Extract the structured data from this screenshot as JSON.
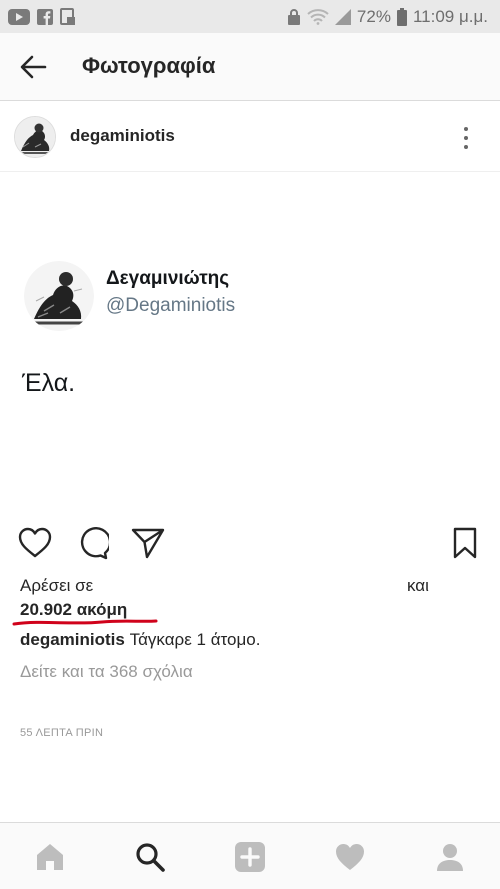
{
  "status_bar": {
    "battery": "72%",
    "time": "11:09 μ.μ.",
    "icons_left": [
      "youtube-icon",
      "facebook-icon",
      "gallery-icon"
    ],
    "icons_right": [
      "lock-icon",
      "wifi-icon",
      "signal-icon",
      "battery-icon"
    ]
  },
  "header": {
    "title": "Φωτογραφία",
    "back_icon": "arrow-left-icon"
  },
  "post": {
    "username": "degaminiotis",
    "menu_icon": "more-vertical-icon",
    "photo": {
      "display_name": "Δεγαμινιώτης",
      "handle": "@Degaminiotis",
      "text": "Έλα."
    },
    "actions": [
      "heart-icon",
      "comment-icon",
      "share-icon",
      "bookmark-icon"
    ],
    "likes_prefix": "Αρέσει σε",
    "likes_and": "και",
    "likes_count": "20.902 ακόμη",
    "caption_user": "degaminiotis",
    "caption_text": " Τάγκαρε 1 άτομο.",
    "comments_link": "Δείτε και τα 368 σχόλια",
    "timestamp": "55 ΛΕΠΤΑ ΠΡΙΝ",
    "underline_color": "#d0021b"
  },
  "bottom_nav": [
    "home-icon",
    "search-icon",
    "add-icon",
    "activity-heart-icon",
    "profile-icon"
  ],
  "colors": {
    "status_bg": "#e9e9e9",
    "text": "#262626",
    "muted": "#999999",
    "twitter_handle": "#657786"
  }
}
